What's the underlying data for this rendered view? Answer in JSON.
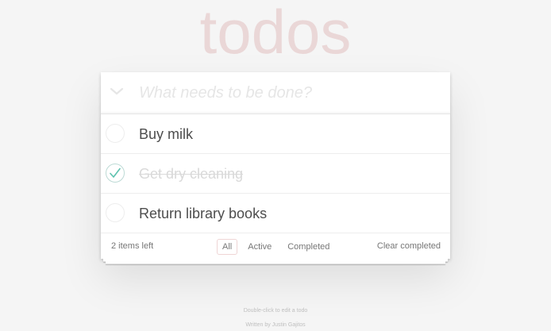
{
  "app": {
    "title": "todos"
  },
  "new_todo": {
    "placeholder": "What needs to be done?",
    "value": ""
  },
  "toggle_all_icon": "chevron-down-icon",
  "todos": [
    {
      "label": "Buy milk",
      "completed": false
    },
    {
      "label": "Get dry cleaning",
      "completed": true
    },
    {
      "label": "Return library books",
      "completed": false
    }
  ],
  "footer": {
    "count": "2 items left",
    "filters": [
      {
        "label": "All",
        "selected": true
      },
      {
        "label": "Active",
        "selected": false
      },
      {
        "label": "Completed",
        "selected": false
      }
    ],
    "clear_completed": "Clear completed"
  },
  "info": {
    "hint": "Double-click to edit a todo",
    "credit": "Written by Justin Gajitos"
  },
  "colors": {
    "background": "#f5f5f5",
    "title": "rgba(175,47,47,0.15)",
    "check": "#5dc2af",
    "completed_text": "#d9d9d9",
    "selected_filter_border": "rgba(175,47,47,0.2)"
  }
}
